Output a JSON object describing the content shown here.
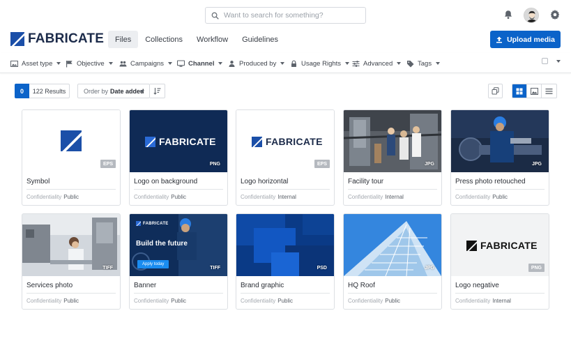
{
  "search": {
    "placeholder": "Want to search for something?"
  },
  "brand": {
    "name": "FABRICATE",
    "color": "#1b4fa8",
    "accent": "#0b63c9"
  },
  "nav": {
    "tabs": [
      {
        "label": "Files",
        "active": true
      },
      {
        "label": "Collections",
        "active": false
      },
      {
        "label": "Workflow",
        "active": false
      },
      {
        "label": "Guidelines",
        "active": false
      }
    ]
  },
  "upload": {
    "label": "Upload media"
  },
  "filters": [
    {
      "label": "Asset type",
      "icon": "image-icon"
    },
    {
      "label": "Objective",
      "icon": "flag-icon"
    },
    {
      "label": "Campaigns",
      "icon": "users-icon"
    },
    {
      "label": "Channel",
      "icon": "monitor-icon",
      "bold": true
    },
    {
      "label": "Produced by",
      "icon": "person-icon"
    },
    {
      "label": "Usage Rights",
      "icon": "lock-icon"
    },
    {
      "label": "Advanced",
      "icon": "sliders-icon"
    },
    {
      "label": "Tags",
      "icon": "tag-icon"
    }
  ],
  "results": {
    "count": "0",
    "label": "122 Results"
  },
  "order": {
    "prefix": "Order by",
    "value": "Date added"
  },
  "assets": [
    {
      "name": "Symbol",
      "format": "EPS",
      "confidentiality_label": "Confidentiality",
      "confidentiality": "Public"
    },
    {
      "name": "Logo on background",
      "format": "PNG",
      "confidentiality_label": "Confidentiality",
      "confidentiality": "Public"
    },
    {
      "name": "Logo horizontal",
      "format": "EPS",
      "confidentiality_label": "Confidentiality",
      "confidentiality": "Internal"
    },
    {
      "name": "Facility tour",
      "format": "JPG",
      "confidentiality_label": "Confidentiality",
      "confidentiality": "Internal"
    },
    {
      "name": "Press photo retouched",
      "format": "JPG",
      "confidentiality_label": "Confidentiality",
      "confidentiality": "Public"
    },
    {
      "name": "Services photo",
      "format": "TIFF",
      "confidentiality_label": "Confidentiality",
      "confidentiality": "Public"
    },
    {
      "name": "Banner",
      "format": "TIFF",
      "confidentiality_label": "Confidentiality",
      "confidentiality": "Public",
      "banner_title": "Build the future",
      "banner_button": "Apply today",
      "banner_brand": "FABRICATE"
    },
    {
      "name": "Brand graphic",
      "format": "PSD",
      "confidentiality_label": "Confidentiality",
      "confidentiality": "Public"
    },
    {
      "name": "HQ Roof",
      "format": "JPG",
      "confidentiality_label": "Confidentiality",
      "confidentiality": "Public"
    },
    {
      "name": "Logo negative",
      "format": "PNG",
      "confidentiality_label": "Confidentiality",
      "confidentiality": "Internal"
    }
  ]
}
